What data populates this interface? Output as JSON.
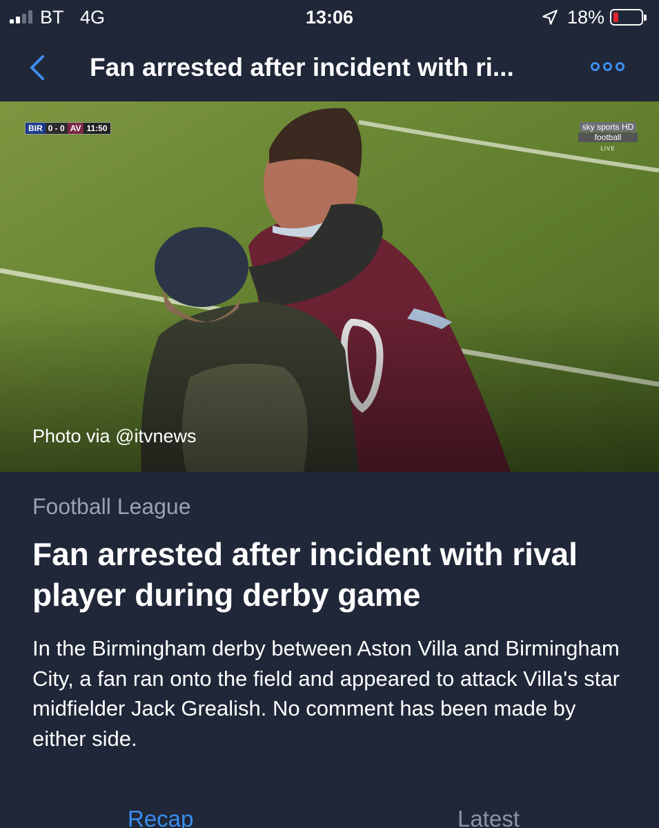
{
  "status_bar": {
    "carrier": "BT",
    "network": "4G",
    "time": "13:06",
    "battery_percent": "18%",
    "battery_level": 0.18,
    "battery_color": "#e3262e",
    "signal_bars": 2,
    "icons": [
      "signal-icon",
      "location-arrow-icon",
      "battery-icon"
    ]
  },
  "nav": {
    "title": "Fan arrested after incident with ri...",
    "back_icon": "chevron-left-icon",
    "more_icon": "more-dots-icon",
    "accent_color": "#3f8ef0"
  },
  "hero": {
    "scorebug": {
      "home": "BIR",
      "score": "0 - 0",
      "away": "AV",
      "time": "11:50"
    },
    "broadcaster": {
      "brand": "sky sports HD",
      "channel": "football",
      "status": "LIVE"
    },
    "photo_credit": "Photo via @itvnews"
  },
  "article": {
    "category": "Football League",
    "headline": "Fan arrested after incident with rival player during derby game",
    "summary": "In the Birmingham derby between Aston Villa and Birmingham City, a fan ran onto the field and appeared to attack Villa's star midfielder Jack Grealish. No comment has been made by either side."
  },
  "tabs": [
    {
      "label": "Recap",
      "active": true
    },
    {
      "label": "Latest",
      "active": false
    }
  ],
  "colors": {
    "background": "#1f2738",
    "muted_text": "#9aa2b2",
    "active_tab": "#3a8cf0"
  }
}
